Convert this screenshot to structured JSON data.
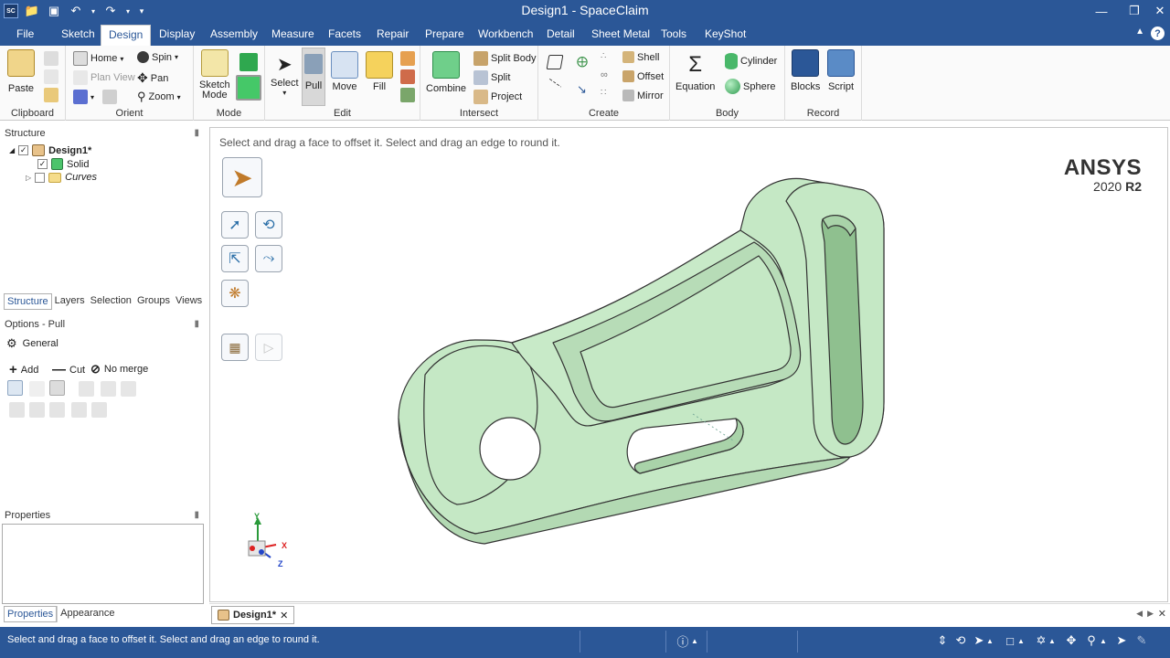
{
  "window": {
    "title": "Design1 - SpaceClaim",
    "app_badge": "SC"
  },
  "menu": {
    "tabs": [
      "File",
      "Sketch",
      "Design",
      "Display",
      "Assembly",
      "Measure",
      "Facets",
      "Repair",
      "Prepare",
      "Workbench",
      "Detail",
      "Sheet Metal",
      "Tools",
      "KeyShot"
    ],
    "active": "Design"
  },
  "ribbon": {
    "clipboard": {
      "label": "Clipboard",
      "paste": "Paste"
    },
    "orient": {
      "label": "Orient",
      "home": "Home",
      "plan_view": "Plan View",
      "spin": "Spin",
      "pan": "Pan",
      "zoom": "Zoom"
    },
    "mode": {
      "label": "Mode",
      "sketch_mode": "Sketch\nMode"
    },
    "edit": {
      "label": "Edit",
      "select": "Select",
      "pull": "Pull",
      "move": "Move",
      "fill": "Fill"
    },
    "intersect": {
      "label": "Intersect",
      "combine": "Combine",
      "split_body": "Split Body",
      "split": "Split",
      "project": "Project"
    },
    "create": {
      "label": "Create",
      "shell": "Shell",
      "offset": "Offset",
      "mirror": "Mirror"
    },
    "body": {
      "label": "Body",
      "equation": "Equation",
      "cylinder": "Cylinder",
      "sphere": "Sphere"
    },
    "record": {
      "label": "Record",
      "blocks": "Blocks",
      "script": "Script"
    }
  },
  "structure": {
    "title": "Structure",
    "root": "Design1*",
    "items": [
      {
        "label": "Solid",
        "checked": true
      },
      {
        "label": "Curves",
        "checked": false
      }
    ],
    "tabs": [
      "Structure",
      "Layers",
      "Selection",
      "Groups",
      "Views"
    ],
    "active_tab": "Structure"
  },
  "options": {
    "title": "Options - Pull",
    "section": "General",
    "add": "Add",
    "cut": "Cut",
    "no_merge": "No merge"
  },
  "properties": {
    "title": "Properties",
    "tabs": [
      "Properties",
      "Appearance"
    ],
    "active_tab": "Properties"
  },
  "viewport": {
    "hint": "Select and drag a face to offset it. Select and drag an edge to round it.",
    "brand": "ANSYS",
    "version_prefix": "2020",
    "version_suffix": "R2",
    "axes": {
      "x": "X",
      "y": "Y",
      "z": "Z"
    },
    "model_color": "#c5e8c5"
  },
  "document_tab": {
    "label": "Design1*"
  },
  "status": {
    "message": "Select and drag a face to offset it. Select and drag an edge to round it."
  },
  "colors": {
    "accent": "#2b5797",
    "model_fill": "#c5e8c5",
    "model_edge": "#333333"
  }
}
